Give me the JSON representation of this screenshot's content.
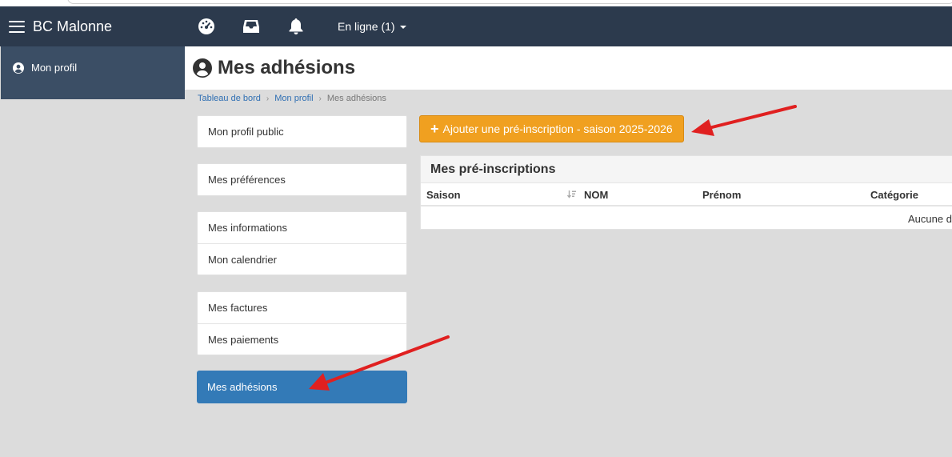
{
  "app": {
    "brand": "BC Malonne",
    "online_status": "En ligne (1)"
  },
  "navbar": {
    "icons": [
      "dashboard-icon",
      "inbox-icon",
      "bell-icon"
    ]
  },
  "sidebar": {
    "items": [
      {
        "label": "Mon profil",
        "icon": "user-circle-icon"
      }
    ]
  },
  "page": {
    "title": "Mes adhésions",
    "icon": "user-circle-icon"
  },
  "breadcrumb": {
    "items": [
      "Tableau de bord",
      "Mon profil"
    ],
    "current": "Mes adhésions",
    "separator": "›"
  },
  "profile_menu": {
    "public_profile": "Mon profil public",
    "preferences": "Mes préférences",
    "information": "Mes informations",
    "calendar": "Mon calendrier",
    "invoices": "Mes factures",
    "payments": "Mes paiements",
    "memberships": "Mes adhésions"
  },
  "actions": {
    "add_preinscription": "Ajouter une pré-inscription - saison 2025-2026"
  },
  "preinscriptions": {
    "title": "Mes pré-inscriptions",
    "columns": [
      "Saison",
      "NOM",
      "Prénom",
      "Catégorie"
    ],
    "empty_text": "Aucune d"
  },
  "colors": {
    "navbar": "#2c3a4d",
    "sidebar": "#3b4e65",
    "accent_orange": "#f0a020",
    "active_blue": "#337ab7",
    "arrow_red": "#e02020"
  }
}
